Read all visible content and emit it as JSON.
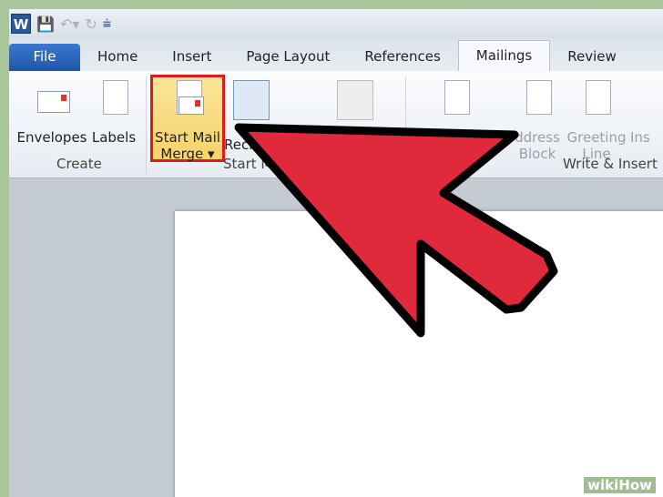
{
  "qat": {
    "app_icon": "word-icon",
    "items": [
      "save-icon",
      "undo-icon",
      "redo-icon",
      "customize-icon"
    ]
  },
  "tabs": [
    "File",
    "Home",
    "Insert",
    "Page Layout",
    "References",
    "Mailings",
    "Review"
  ],
  "active_tab": "Mailings",
  "ribbon": {
    "buttons": [
      {
        "label": "Envelopes"
      },
      {
        "label": "Labels"
      },
      {
        "label1": "Start Mail",
        "label2": "Merge"
      },
      {
        "label": "Reci"
      },
      {
        "label1": "ddress",
        "label2": "Block"
      },
      {
        "label1": "Greeting",
        "label2": "Line"
      },
      {
        "label": "Ins"
      }
    ],
    "groups": [
      "Create",
      "Start M",
      "Write & Insert"
    ]
  },
  "highlight_color": "#e01a1a",
  "arrow_color": "#e0293a",
  "watermark": "wikiHow"
}
